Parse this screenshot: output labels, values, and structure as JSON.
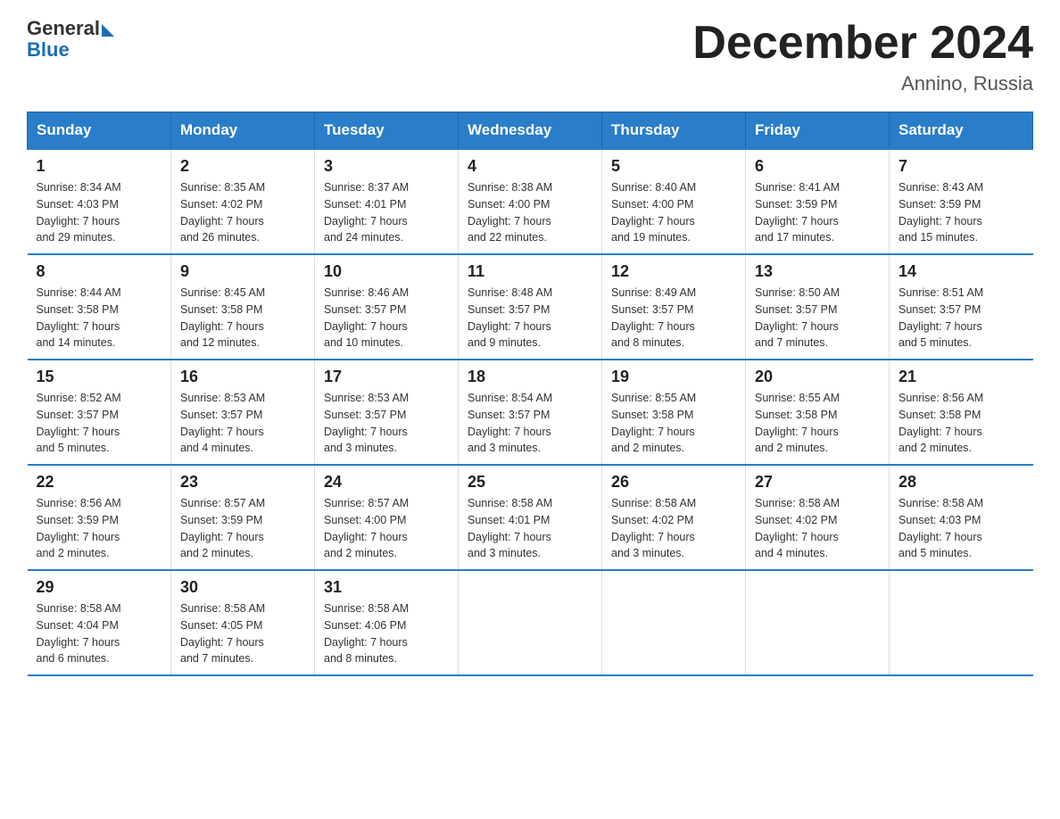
{
  "header": {
    "logo_text_general": "General",
    "logo_text_blue": "Blue",
    "month_title": "December 2024",
    "location": "Annino, Russia"
  },
  "days_of_week": [
    "Sunday",
    "Monday",
    "Tuesday",
    "Wednesday",
    "Thursday",
    "Friday",
    "Saturday"
  ],
  "weeks": [
    [
      {
        "day": "1",
        "info": "Sunrise: 8:34 AM\nSunset: 4:03 PM\nDaylight: 7 hours\nand 29 minutes."
      },
      {
        "day": "2",
        "info": "Sunrise: 8:35 AM\nSunset: 4:02 PM\nDaylight: 7 hours\nand 26 minutes."
      },
      {
        "day": "3",
        "info": "Sunrise: 8:37 AM\nSunset: 4:01 PM\nDaylight: 7 hours\nand 24 minutes."
      },
      {
        "day": "4",
        "info": "Sunrise: 8:38 AM\nSunset: 4:00 PM\nDaylight: 7 hours\nand 22 minutes."
      },
      {
        "day": "5",
        "info": "Sunrise: 8:40 AM\nSunset: 4:00 PM\nDaylight: 7 hours\nand 19 minutes."
      },
      {
        "day": "6",
        "info": "Sunrise: 8:41 AM\nSunset: 3:59 PM\nDaylight: 7 hours\nand 17 minutes."
      },
      {
        "day": "7",
        "info": "Sunrise: 8:43 AM\nSunset: 3:59 PM\nDaylight: 7 hours\nand 15 minutes."
      }
    ],
    [
      {
        "day": "8",
        "info": "Sunrise: 8:44 AM\nSunset: 3:58 PM\nDaylight: 7 hours\nand 14 minutes."
      },
      {
        "day": "9",
        "info": "Sunrise: 8:45 AM\nSunset: 3:58 PM\nDaylight: 7 hours\nand 12 minutes."
      },
      {
        "day": "10",
        "info": "Sunrise: 8:46 AM\nSunset: 3:57 PM\nDaylight: 7 hours\nand 10 minutes."
      },
      {
        "day": "11",
        "info": "Sunrise: 8:48 AM\nSunset: 3:57 PM\nDaylight: 7 hours\nand 9 minutes."
      },
      {
        "day": "12",
        "info": "Sunrise: 8:49 AM\nSunset: 3:57 PM\nDaylight: 7 hours\nand 8 minutes."
      },
      {
        "day": "13",
        "info": "Sunrise: 8:50 AM\nSunset: 3:57 PM\nDaylight: 7 hours\nand 7 minutes."
      },
      {
        "day": "14",
        "info": "Sunrise: 8:51 AM\nSunset: 3:57 PM\nDaylight: 7 hours\nand 5 minutes."
      }
    ],
    [
      {
        "day": "15",
        "info": "Sunrise: 8:52 AM\nSunset: 3:57 PM\nDaylight: 7 hours\nand 5 minutes."
      },
      {
        "day": "16",
        "info": "Sunrise: 8:53 AM\nSunset: 3:57 PM\nDaylight: 7 hours\nand 4 minutes."
      },
      {
        "day": "17",
        "info": "Sunrise: 8:53 AM\nSunset: 3:57 PM\nDaylight: 7 hours\nand 3 minutes."
      },
      {
        "day": "18",
        "info": "Sunrise: 8:54 AM\nSunset: 3:57 PM\nDaylight: 7 hours\nand 3 minutes."
      },
      {
        "day": "19",
        "info": "Sunrise: 8:55 AM\nSunset: 3:58 PM\nDaylight: 7 hours\nand 2 minutes."
      },
      {
        "day": "20",
        "info": "Sunrise: 8:55 AM\nSunset: 3:58 PM\nDaylight: 7 hours\nand 2 minutes."
      },
      {
        "day": "21",
        "info": "Sunrise: 8:56 AM\nSunset: 3:58 PM\nDaylight: 7 hours\nand 2 minutes."
      }
    ],
    [
      {
        "day": "22",
        "info": "Sunrise: 8:56 AM\nSunset: 3:59 PM\nDaylight: 7 hours\nand 2 minutes."
      },
      {
        "day": "23",
        "info": "Sunrise: 8:57 AM\nSunset: 3:59 PM\nDaylight: 7 hours\nand 2 minutes."
      },
      {
        "day": "24",
        "info": "Sunrise: 8:57 AM\nSunset: 4:00 PM\nDaylight: 7 hours\nand 2 minutes."
      },
      {
        "day": "25",
        "info": "Sunrise: 8:58 AM\nSunset: 4:01 PM\nDaylight: 7 hours\nand 3 minutes."
      },
      {
        "day": "26",
        "info": "Sunrise: 8:58 AM\nSunset: 4:02 PM\nDaylight: 7 hours\nand 3 minutes."
      },
      {
        "day": "27",
        "info": "Sunrise: 8:58 AM\nSunset: 4:02 PM\nDaylight: 7 hours\nand 4 minutes."
      },
      {
        "day": "28",
        "info": "Sunrise: 8:58 AM\nSunset: 4:03 PM\nDaylight: 7 hours\nand 5 minutes."
      }
    ],
    [
      {
        "day": "29",
        "info": "Sunrise: 8:58 AM\nSunset: 4:04 PM\nDaylight: 7 hours\nand 6 minutes."
      },
      {
        "day": "30",
        "info": "Sunrise: 8:58 AM\nSunset: 4:05 PM\nDaylight: 7 hours\nand 7 minutes."
      },
      {
        "day": "31",
        "info": "Sunrise: 8:58 AM\nSunset: 4:06 PM\nDaylight: 7 hours\nand 8 minutes."
      },
      {
        "day": "",
        "info": ""
      },
      {
        "day": "",
        "info": ""
      },
      {
        "day": "",
        "info": ""
      },
      {
        "day": "",
        "info": ""
      }
    ]
  ]
}
